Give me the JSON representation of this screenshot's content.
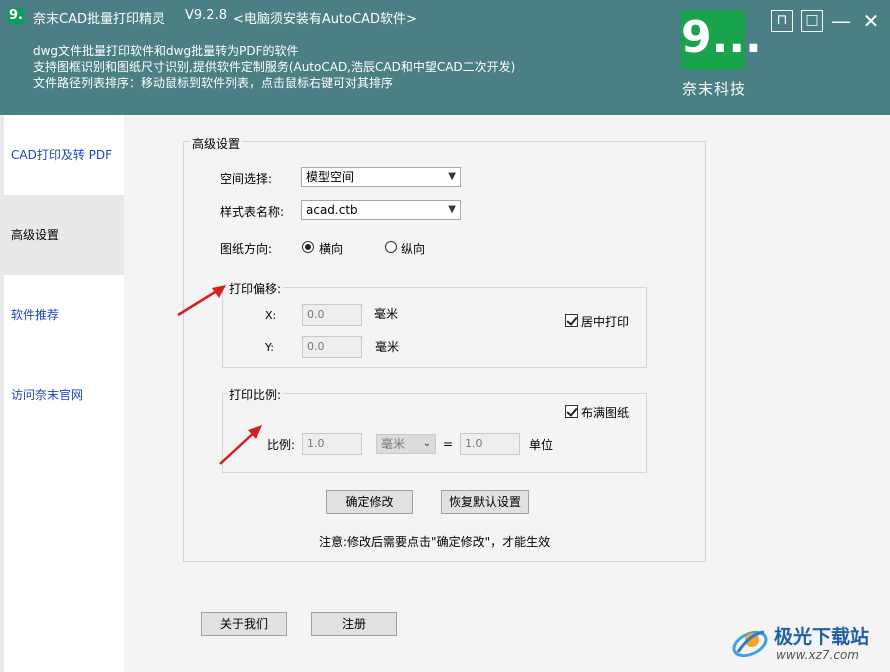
{
  "header": {
    "logo_glyph": "9.",
    "title": "奈末CAD批量打印精灵",
    "version": "V9.2.8",
    "note": "<电脑须安装有AutoCAD软件>",
    "desc_lines": [
      "dwg文件批量打印软件和dwg批量转为PDF的软件",
      "支持图框识别和图纸尺寸识别,提供软件定制服务(AutoCAD,浩辰CAD和中望CAD二次开发)",
      "文件路径列表排序：移动鼠标到软件列表，点击鼠标右键可对其排序"
    ],
    "brand_glyph": "9...",
    "brand_name": "奈末科技",
    "window_buttons": {
      "pin": "⊓",
      "restore": "□",
      "minimize": "—",
      "close": "✕"
    }
  },
  "sidebar": {
    "items": [
      {
        "label": "CAD打印及转 PDF"
      },
      {
        "label": "高级设置"
      },
      {
        "label": "软件推荐"
      },
      {
        "label": "访问奈末官网"
      }
    ]
  },
  "settings": {
    "group_title": "高级设置",
    "space_label": "空间选择:",
    "space_value": "模型空间",
    "style_label": "样式表名称:",
    "style_value": "acad.ctb",
    "orientation_label": "图纸方向:",
    "orientation_options": [
      "横向",
      "纵向"
    ],
    "orientation_selected": "横向",
    "offset": {
      "title": "打印偏移:",
      "x_label": "X:",
      "x_value": "0.0",
      "x_unit": "毫米",
      "y_label": "Y:",
      "y_value": "0.0",
      "y_unit": "毫米",
      "center_label": "居中打印",
      "center_checked": true
    },
    "scale": {
      "title": "打印比例:",
      "fill_label": "布满图纸",
      "fill_checked": true,
      "ratio_label": "比例:",
      "ratio_value": "1.0",
      "unit_select": "毫米",
      "equals": "=",
      "unit_value": "1.0",
      "unit_label": "单位"
    },
    "confirm_button": "确定修改",
    "reset_button": "恢复默认设置",
    "notice": "注意:修改后需要点击\"确定修改\"，才能生效"
  },
  "footer": {
    "about_button": "关于我们",
    "register_button": "注册"
  },
  "watermark": {
    "name": "极光下载站",
    "url": "www.xz7.com"
  },
  "colors": {
    "header_bg": "#4a7f86",
    "brand_green": "#1aa34d",
    "link_blue": "#1a47c2",
    "arrow_red": "#d81e1e"
  }
}
